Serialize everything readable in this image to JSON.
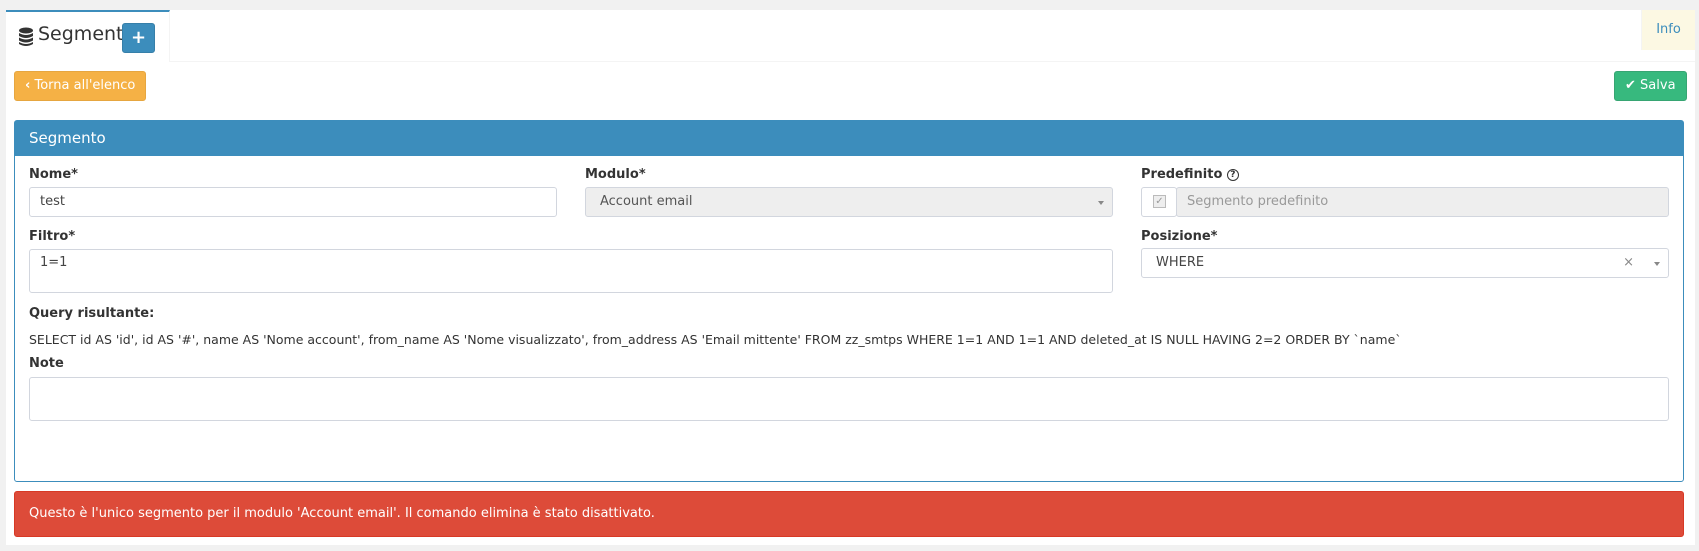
{
  "header": {
    "title": "Segmenti",
    "add_label": "+",
    "info_label": "Info"
  },
  "actions": {
    "back_label": "Torna all'elenco",
    "save_label": "Salva"
  },
  "panel": {
    "title": "Segmento",
    "nome": {
      "label": "Nome*",
      "value": "test"
    },
    "modulo": {
      "label": "Modulo*",
      "value": "Account email"
    },
    "predefinito": {
      "label": "Predefinito",
      "help_icon": "?",
      "value": "Segmento predefinito"
    },
    "filtro": {
      "label": "Filtro*",
      "value": "1=1"
    },
    "posizione": {
      "label": "Posizione*",
      "value": "WHERE",
      "clear": "×"
    },
    "query": {
      "label": "Query risultante:",
      "value": "SELECT id AS 'id', id AS '#', name AS 'Nome account', from_name AS 'Nome visualizzato', from_address AS 'Email mittente' FROM zz_smtps WHERE 1=1 AND 1=1 AND deleted_at IS NULL HAVING 2=2 ORDER BY `name`"
    },
    "note": {
      "label": "Note",
      "value": ""
    }
  },
  "alert": {
    "message": "Questo è l'unico segmento per il modulo 'Account email'. Il comando elimina è stato disattivato."
  },
  "colors": {
    "primary": "#3c8dbc",
    "warning": "#f39c12",
    "success": "#00a65a",
    "danger": "#dd4b39",
    "info_bg": "#fcf8e3"
  },
  "icons": {
    "module_icon": "database-icon",
    "back_icon": "chevron-left-icon",
    "save_icon": "check-icon",
    "help_icon": "question-circle-icon"
  }
}
